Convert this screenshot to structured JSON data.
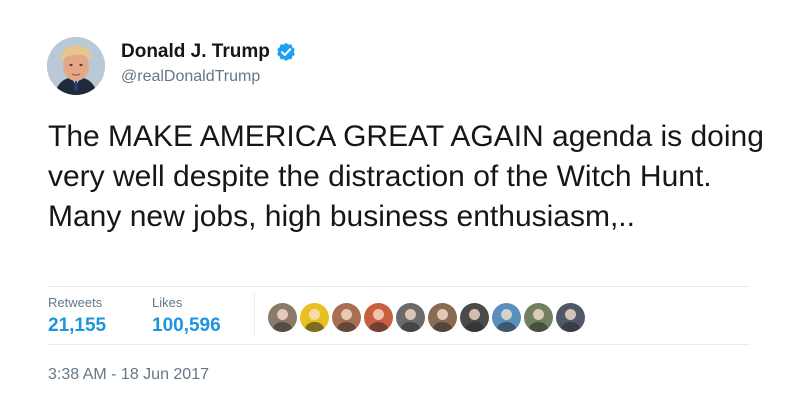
{
  "author": {
    "display_name": "Donald J. Trump",
    "handle": "@realDonaldTrump",
    "verified": true,
    "verified_color": "#1da1f2"
  },
  "tweet": {
    "text": "The MAKE AMERICA GREAT AGAIN agenda is doing very well despite the distraction of the Witch Hunt. Many new jobs, high business enthusiasm,.."
  },
  "stats": {
    "retweets_label": "Retweets",
    "retweets_value": "21,155",
    "likes_label": "Likes",
    "likes_value": "100,596",
    "accent_color": "#1b95e0"
  },
  "likers": [
    {
      "icon": "user-avatar-icon",
      "color": "#8a7a6a"
    },
    {
      "icon": "user-avatar-icon",
      "color": "#e8c020"
    },
    {
      "icon": "user-avatar-icon",
      "color": "#a87050"
    },
    {
      "icon": "user-avatar-icon",
      "color": "#c86040"
    },
    {
      "icon": "user-avatar-icon",
      "color": "#6a6a6a"
    },
    {
      "icon": "user-avatar-icon",
      "color": "#8a6a50"
    },
    {
      "icon": "user-avatar-icon",
      "color": "#4a4a4a"
    },
    {
      "icon": "user-avatar-icon",
      "color": "#5a90c0"
    },
    {
      "icon": "user-avatar-icon",
      "color": "#708060"
    },
    {
      "icon": "user-avatar-icon",
      "color": "#505868"
    }
  ],
  "timestamp": "3:38 AM - 18 Jun 2017"
}
